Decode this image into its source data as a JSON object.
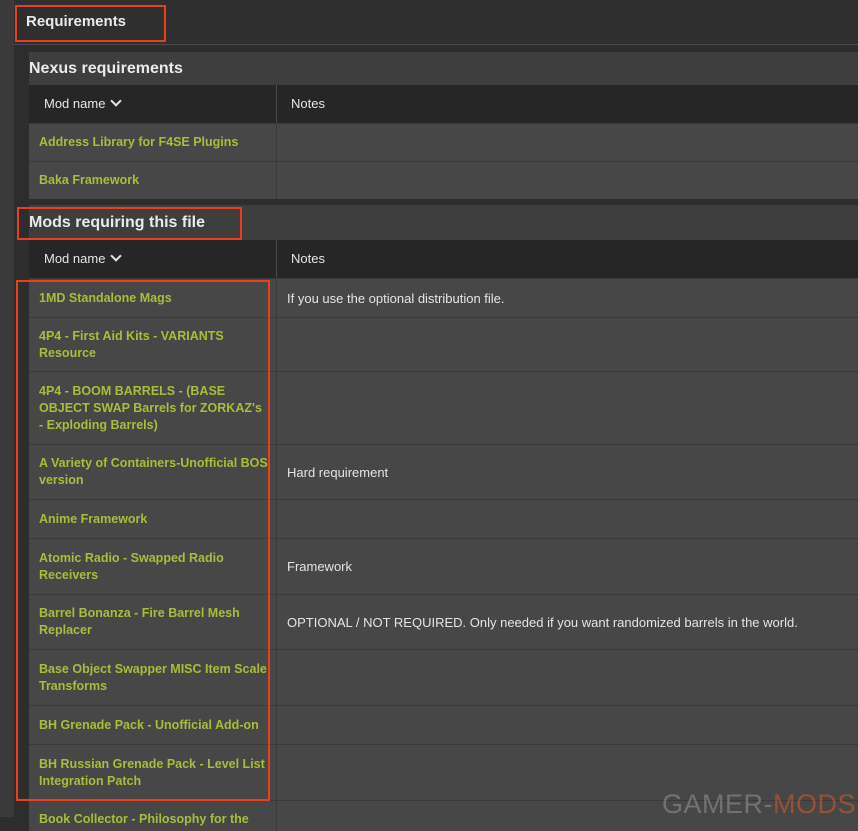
{
  "page": {
    "requirements_title": "Requirements",
    "watermark_part1": "GAMER-",
    "watermark_part2": "MODS"
  },
  "nexus": {
    "title": "Nexus requirements",
    "col_mod": "Mod name",
    "col_notes": "Notes",
    "rows": [
      {
        "name": "Address Library for F4SE Plugins",
        "notes": ""
      },
      {
        "name": "Baka Framework",
        "notes": ""
      }
    ]
  },
  "requiring": {
    "title": "Mods requiring this file",
    "col_mod": "Mod name",
    "col_notes": "Notes",
    "rows": [
      {
        "name": "1MD Standalone Mags",
        "notes": "If you use the optional distribution file."
      },
      {
        "name": "4P4 - First Aid Kits - VARIANTS Resource",
        "notes": ""
      },
      {
        "name": "4P4 - BOOM BARRELS - (BASE OBJECT SWAP Barrels for ZORKAZ's - Exploding Barrels)",
        "notes": ""
      },
      {
        "name": "A Variety of Containers-Unofficial BOS version",
        "notes": "Hard requirement"
      },
      {
        "name": "Anime Framework",
        "notes": ""
      },
      {
        "name": "Atomic Radio - Swapped Radio Receivers",
        "notes": "Framework"
      },
      {
        "name": "Barrel Bonanza - Fire Barrel Mesh Replacer",
        "notes": "OPTIONAL / NOT REQUIRED. Only needed if you want randomized barrels in the world."
      },
      {
        "name": "Base Object Swapper MISC Item Scale Transforms",
        "notes": ""
      },
      {
        "name": "BH Grenade Pack - Unofficial Add-on",
        "notes": ""
      },
      {
        "name": "BH Russian Grenade Pack - Level List Integration Patch",
        "notes": ""
      },
      {
        "name": "Book Collector - Philosophy for the",
        "notes": ""
      }
    ]
  },
  "colors": {
    "link": "#a8bd3a",
    "highlight": "#e8401c",
    "row_bg": "#474747",
    "header_bg": "#262626"
  }
}
